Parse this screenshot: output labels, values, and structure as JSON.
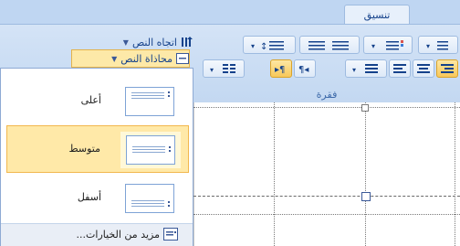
{
  "ribbon": {
    "tabs": [
      {
        "label": "تنسيق"
      }
    ],
    "text_direction_label": "اتجاه النص",
    "text_align_label": "محاذاة النص",
    "group_label": "فقرة"
  },
  "menu": {
    "items": [
      {
        "label": "أعلى",
        "selected": false
      },
      {
        "label": "متوسط",
        "selected": true
      },
      {
        "label": "أسفل",
        "selected": false
      }
    ],
    "more_options_label": "مزيد من الخيارات..."
  },
  "colors": {
    "accent": "#fde9a8",
    "selected_border": "#f2b84e",
    "ribbon": "#cfe0f5",
    "text": "#15428b"
  }
}
